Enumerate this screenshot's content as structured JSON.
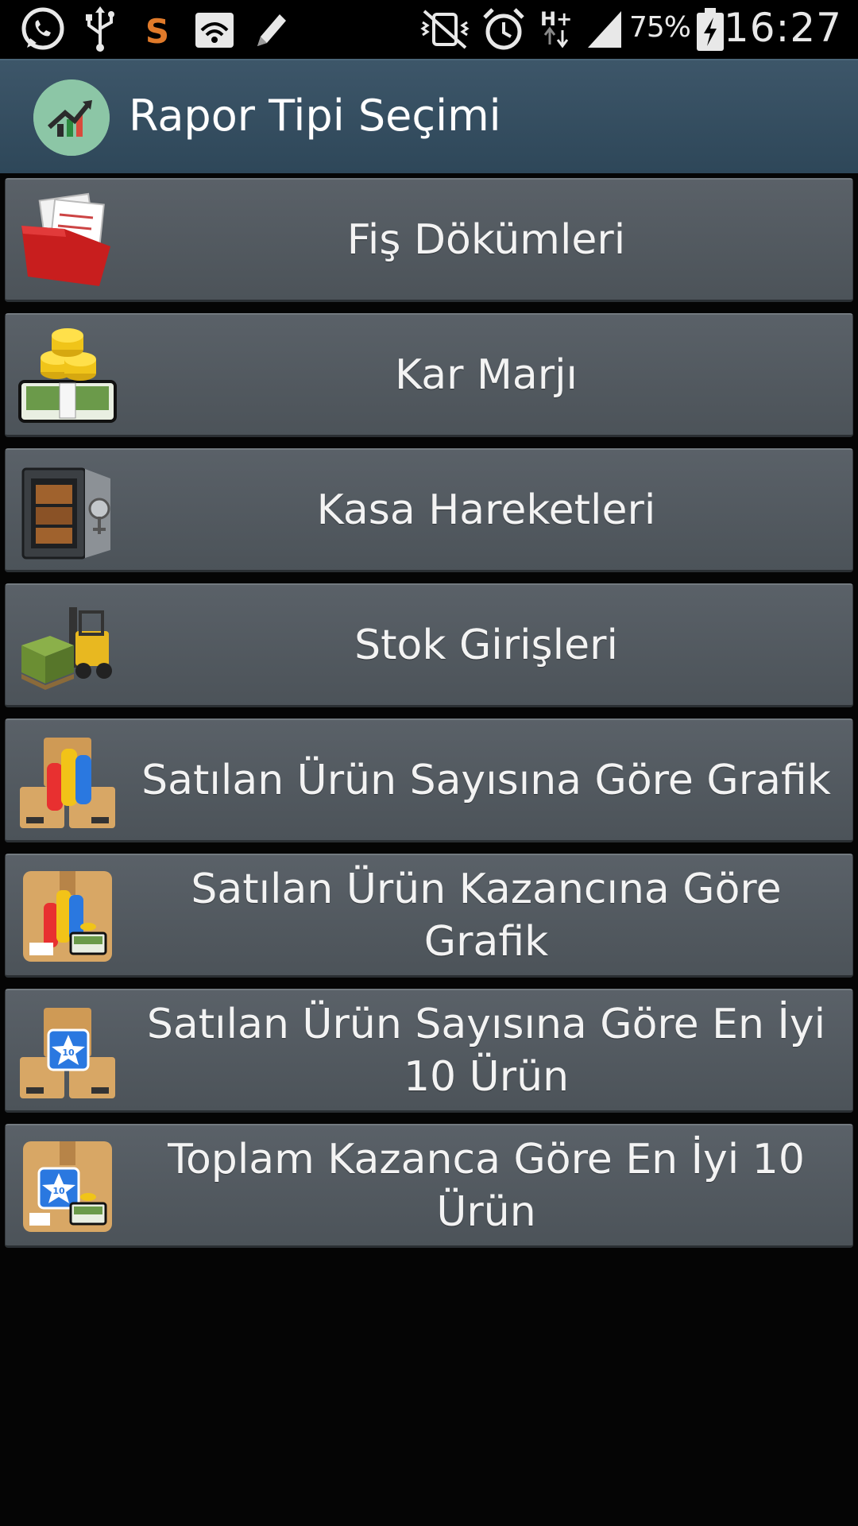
{
  "status_bar": {
    "battery_percent": "75%",
    "time": "16:27",
    "left_icons": [
      "whatsapp-icon",
      "usb-icon",
      "s-app-icon",
      "wifi-icon",
      "pen-icon"
    ],
    "right_icons": [
      "vibrate-mute-icon",
      "alarm-icon",
      "hplus-data-icon",
      "signal-icon",
      "battery-charging-icon"
    ]
  },
  "action_bar": {
    "title": "Rapor Tipi Seçimi",
    "logo_icon": "chart-trend-logo-icon"
  },
  "menu": {
    "items": [
      {
        "label": "Fiş Dökümleri",
        "icon": "red-folder-receipts-icon"
      },
      {
        "label": "Kar Marjı",
        "icon": "coins-money-stack-icon"
      },
      {
        "label": "Kasa Hareketleri",
        "icon": "safe-vault-icon"
      },
      {
        "label": "Stok Girişleri",
        "icon": "forklift-pallet-icon"
      },
      {
        "label": "Satılan Ürün Sayısına Göre Grafik",
        "icon": "boxes-bar-chart-icon"
      },
      {
        "label": "Satılan Ürün Kazancına Göre Grafik",
        "icon": "box-chart-money-icon"
      },
      {
        "label": "Satılan Ürün Sayısına Göre En İyi 10 Ürün",
        "icon": "boxes-top10-star-icon"
      },
      {
        "label": "Toplam Kazanca Göre En İyi 10 Ürün",
        "icon": "box-top10-money-icon"
      }
    ]
  },
  "colors": {
    "action_bar": "#34505f",
    "item_bg": "#535a60",
    "background": "#050505",
    "text": "#f3f3f3"
  }
}
